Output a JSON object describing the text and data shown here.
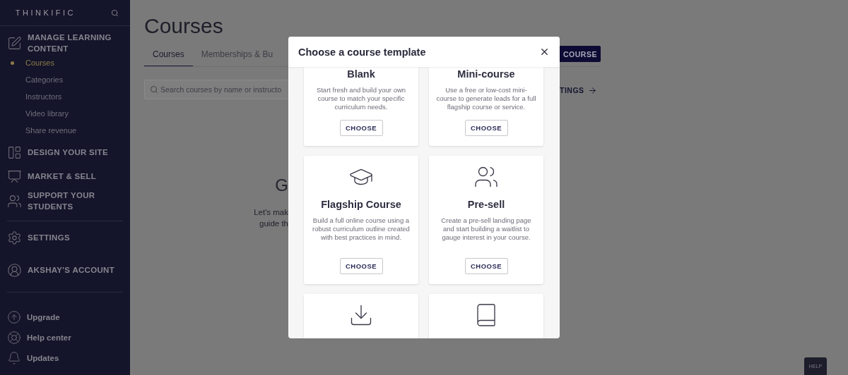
{
  "sidebar": {
    "logo": "THINKIFIC",
    "sections": [
      {
        "label": "MANAGE LEARNING CONTENT",
        "items": [
          {
            "label": "Courses",
            "selected": true
          },
          {
            "label": "Categories",
            "selected": false
          },
          {
            "label": "Instructors",
            "selected": false
          },
          {
            "label": "Video library",
            "selected": false
          },
          {
            "label": "Share revenue",
            "selected": false
          }
        ]
      },
      {
        "label": "DESIGN YOUR SITE"
      },
      {
        "label": "MARKET & SELL"
      },
      {
        "label": "SUPPORT YOUR STUDENTS"
      }
    ],
    "account": [
      {
        "label": "SETTINGS"
      },
      {
        "label": "AKSHAY'S ACCOUNT"
      }
    ],
    "links": [
      {
        "label": "Upgrade"
      },
      {
        "label": "Help center"
      },
      {
        "label": "Updates"
      }
    ]
  },
  "page": {
    "title": "Courses",
    "tabs": [
      {
        "label": "Courses",
        "selected": true
      },
      {
        "label": "Memberships & Bu",
        "selected": false
      }
    ],
    "search": {
      "placeholder": "Search courses by name or instructo"
    },
    "empty_state": {
      "heading": "G",
      "lines": [
        "Let's mak",
        "guide th"
      ]
    },
    "new_course_button": "COURSE",
    "settings_link": "TINGS"
  },
  "modal": {
    "title": "Choose a course template",
    "cards": [
      {
        "title": "Blank",
        "description": "Start fresh and build your own course to match your specific curriculum needs.",
        "button": "CHOOSE"
      },
      {
        "title": "Mini-course",
        "description": "Use a free or low-cost mini-course to generate leads for a full flagship course or service.",
        "button": "CHOOSE"
      },
      {
        "title": "Flagship Course",
        "description": "Build a full online course using a robust curriculum outline created with best practices in mind.",
        "button": "CHOOSE"
      },
      {
        "title": "Pre-sell",
        "description": "Create a pre-sell landing page and start building a waitlist to gauge interest in your course.",
        "button": "CHOOSE"
      },
      {
        "kind": "icon_only"
      },
      {
        "kind": "icon_only"
      }
    ]
  },
  "help_button": "HELP"
}
